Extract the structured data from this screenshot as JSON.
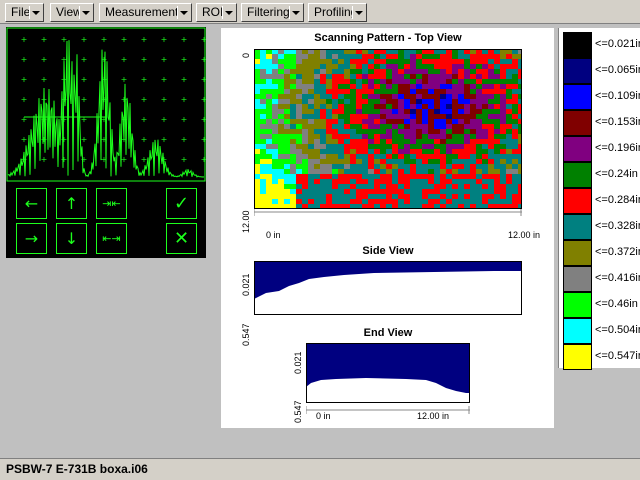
{
  "menu": [
    {
      "label": "File"
    },
    {
      "label": "View"
    },
    {
      "label": "Measurements"
    },
    {
      "label": "ROI"
    },
    {
      "label": "Filtering"
    },
    {
      "label": "Profiling"
    }
  ],
  "scope": {
    "trace_color": "#1cff1c",
    "buttons": {
      "left": "←",
      "up": "↑",
      "converge": "⇥⇤",
      "check": "✓",
      "right": "→",
      "down": "↓",
      "diverge": "⇤⇥",
      "cross": "✕"
    }
  },
  "top_view": {
    "title": "Scanning Pattern - Top View",
    "y_top": "0",
    "y_bottom": "12.00",
    "x_left": "0 in",
    "x_right": "12.00 in"
  },
  "side_view": {
    "title": "Side View",
    "y_top": "0.021",
    "y_bottom": "0.547"
  },
  "end_view": {
    "title": "End View",
    "y_top": "0.021",
    "y_bottom": "0.547",
    "x_left": "0 in",
    "x_right": "12.00 in"
  },
  "legend": [
    {
      "label": "<=0.021in",
      "color": "#000000"
    },
    {
      "label": "<=0.065in",
      "color": "#000080"
    },
    {
      "label": "<=0.109in",
      "color": "#0000ff"
    },
    {
      "label": "<=0.153in",
      "color": "#800000"
    },
    {
      "label": "<=0.196in",
      "color": "#800080"
    },
    {
      "label": "<=0.24in",
      "color": "#008000"
    },
    {
      "label": "<=0.284in",
      "color": "#ff0000"
    },
    {
      "label": "<=0.328in",
      "color": "#008080"
    },
    {
      "label": "<=0.372in",
      "color": "#808000"
    },
    {
      "label": "<=0.416in",
      "color": "#808080"
    },
    {
      "label": "<=0.46in",
      "color": "#00ff00"
    },
    {
      "label": "<=0.504in",
      "color": "#00ffff"
    },
    {
      "label": "<=0.547in",
      "color": "#ffff00"
    }
  ],
  "status": {
    "text": "PSBW-7 E-731B boxa.i06"
  }
}
